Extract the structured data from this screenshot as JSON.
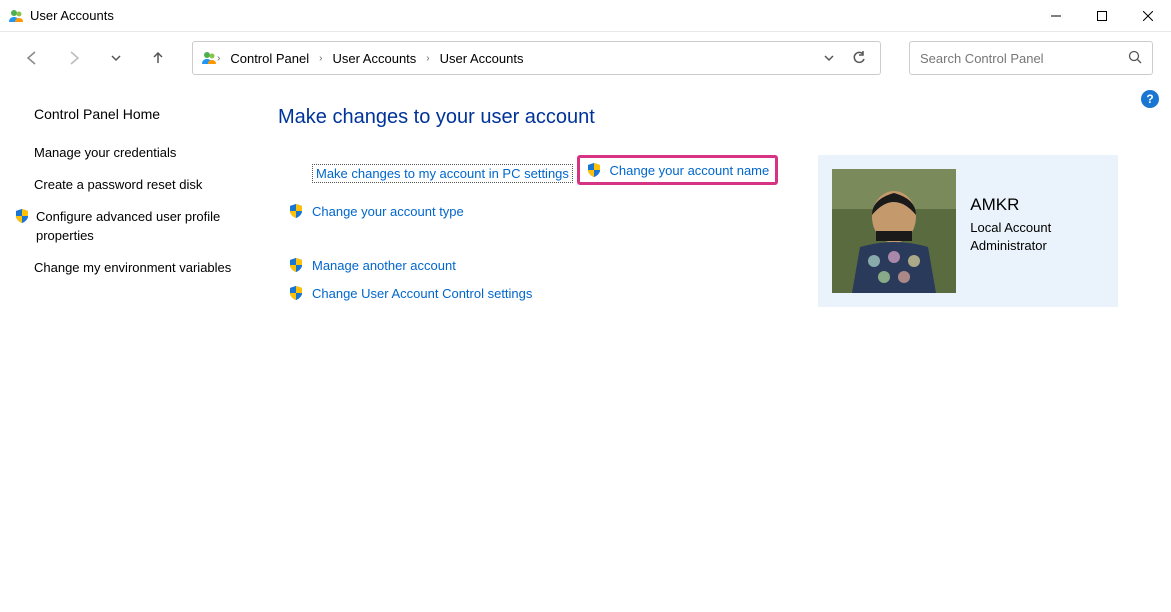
{
  "window": {
    "title": "User Accounts"
  },
  "breadcrumb": {
    "root": "Control Panel",
    "level1": "User Accounts",
    "level2": "User Accounts"
  },
  "search": {
    "placeholder": "Search Control Panel"
  },
  "sidebar": {
    "home": "Control Panel Home",
    "items": [
      {
        "label": "Manage your credentials",
        "shield": false
      },
      {
        "label": "Create a password reset disk",
        "shield": false
      },
      {
        "label": "Configure advanced user profile properties",
        "shield": true
      },
      {
        "label": "Change my environment variables",
        "shield": false
      }
    ]
  },
  "main": {
    "heading": "Make changes to your user account",
    "pc_settings_link": "Make changes to my account in PC settings",
    "change_name": "Change your account name",
    "change_type": "Change your account type",
    "manage_another": "Manage another account",
    "change_uac": "Change User Account Control settings"
  },
  "account": {
    "name": "AMKR",
    "type": "Local Account",
    "role": "Administrator"
  }
}
